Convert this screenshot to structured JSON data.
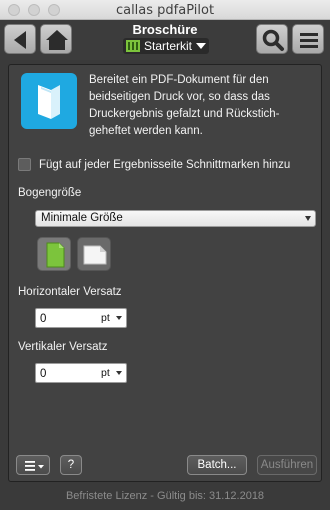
{
  "window": {
    "title": "callas pdfaPilot"
  },
  "toolbar": {
    "back_icon": "triangle-left-icon",
    "home_icon": "home-icon",
    "search_icon": "search-icon",
    "menu_icon": "hamburger-icon",
    "preset_title": "Broschüre",
    "kit_label": "Starterkit"
  },
  "preset": {
    "icon": "booklet-icon",
    "icon_color": "#1fa9e1",
    "description_lines": [
      "Bereitet ein PDF-Dokument für den",
      "beidseitigen Druck vor, so dass das",
      "Druckergebnis gefalzt und Rückstich-",
      "geheftet werden kann."
    ]
  },
  "options": {
    "crop_marks_label": "Fügt auf jeder Ergebnisseite Schnittmarken hinzu",
    "crop_marks_checked": false,
    "sheet_size_label": "Bogengröße",
    "sheet_size_value": "Minimale Größe",
    "horizontal_offset_label": "Horizontaler Versatz",
    "horizontal_offset_value": "0",
    "horizontal_offset_unit": "pt",
    "vertical_offset_label": "Vertikaler Versatz",
    "vertical_offset_value": "0",
    "vertical_offset_unit": "pt"
  },
  "bottom_bar": {
    "menu_icon": "list-menu-icon",
    "help_label": "?",
    "batch_label": "Batch...",
    "run_label": "Ausführen"
  },
  "footer": {
    "license_text": "Befristete Lizenz - Gültig bis: 31.12.2018"
  }
}
